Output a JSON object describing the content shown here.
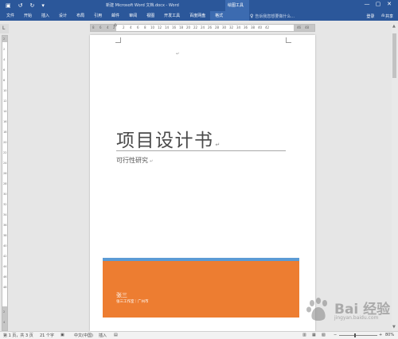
{
  "window": {
    "title": "新建 Microsoft Word 文档.docx - Word",
    "context_tab_group": "绘图工具",
    "controls": [
      "—",
      "▢",
      "✕"
    ]
  },
  "quick_access": {
    "save_icon": "save-icon",
    "undo_icon": "undo-icon",
    "redo_icon": "redo-icon",
    "customize_icon": "dropdown-icon"
  },
  "ribbon": {
    "tabs": [
      "文件",
      "开始",
      "插入",
      "设计",
      "布局",
      "引用",
      "邮件",
      "审阅",
      "视图",
      "开发工具",
      "百度网盘",
      "格式"
    ],
    "active_tab": "格式",
    "tell_me": "告诉我您想要做什么...",
    "sign_in": "登录",
    "share": "共享"
  },
  "ruler": {
    "h_ticks": [
      "8",
      "6",
      "4",
      "2",
      "2",
      "4",
      "6",
      "8",
      "10",
      "12",
      "14",
      "16",
      "18",
      "20",
      "22",
      "24",
      "26",
      "28",
      "30",
      "32",
      "34",
      "36",
      "38",
      "40",
      "42",
      "46",
      "48"
    ],
    "v_ticks": [
      "2",
      "2",
      "4",
      "6",
      "8",
      "10",
      "12",
      "14",
      "16",
      "18",
      "20",
      "22",
      "24",
      "26",
      "28",
      "30",
      "32",
      "34",
      "36",
      "38",
      "40",
      "42",
      "44",
      "46",
      "48",
      "2",
      "4"
    ]
  },
  "document": {
    "title": "项目设计书",
    "subtitle": "可行性研究",
    "author": "张三",
    "company": "张三工作室｜广州市"
  },
  "status": {
    "page": "第 1 页，共 3 页",
    "words": "21 个字",
    "language": "中文(中国)",
    "mode": "插入",
    "zoom": "80%",
    "zoom_level": 0.8
  },
  "watermark": {
    "brand": "Bai 经验",
    "site": "jingyan.baidu.com"
  },
  "colors": {
    "ribbon": "#2b579a",
    "cover_orange": "#ed7d31",
    "cover_blue": "#5b9bd5"
  }
}
